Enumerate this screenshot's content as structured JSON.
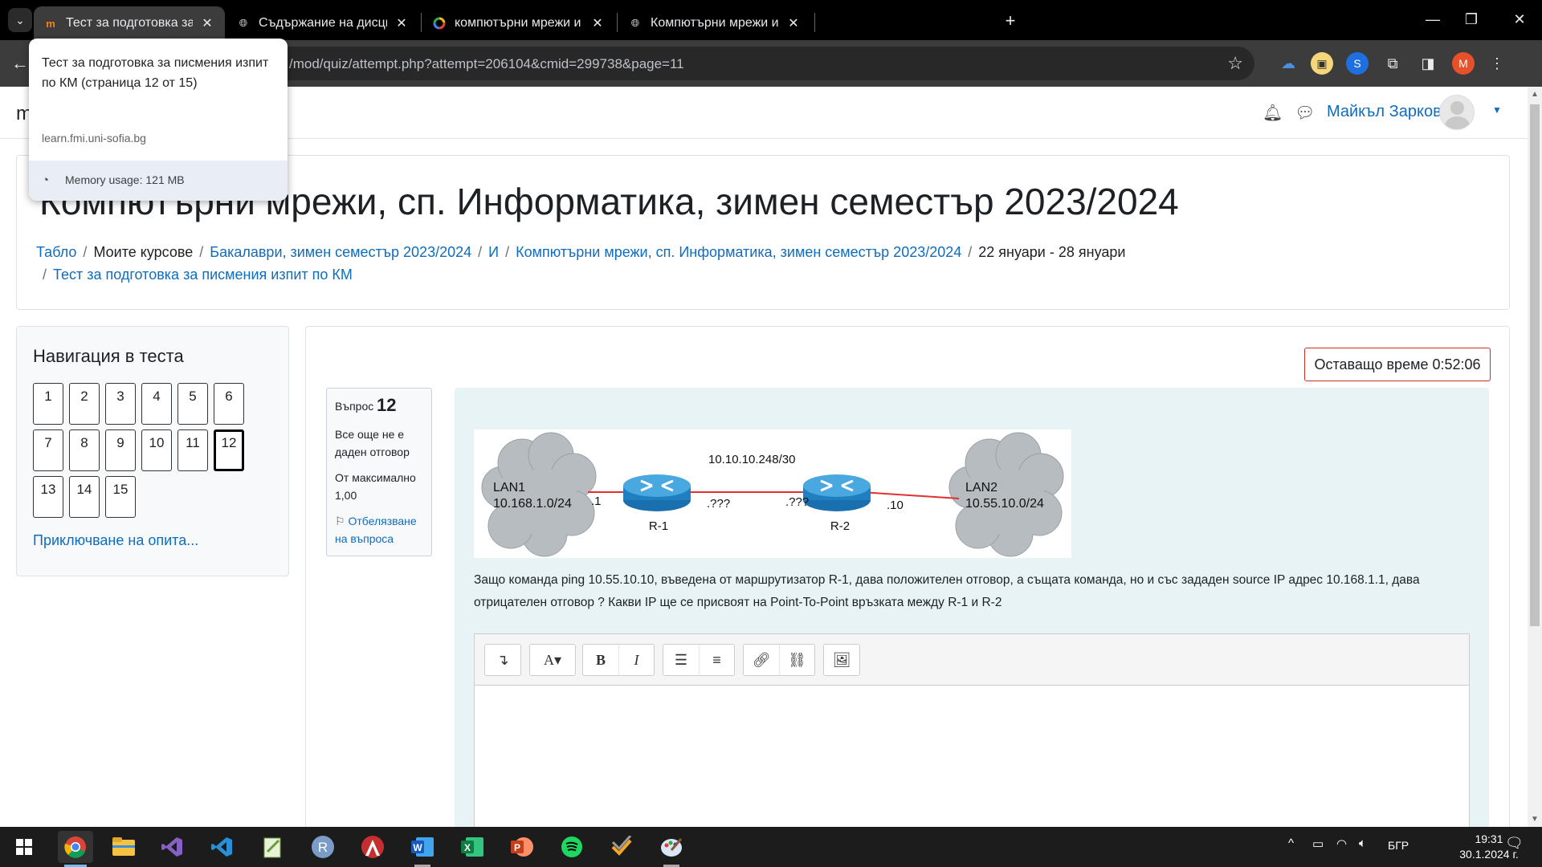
{
  "browser": {
    "tabs": [
      {
        "title": "Тест за подготовка за писмени",
        "active": true
      },
      {
        "title": "Съдържание на дисциплината",
        "active": false
      },
      {
        "title": "компютърни мрежи и телеком",
        "active": false
      },
      {
        "title": "Компютърни мрежи и телеком",
        "active": false
      }
    ],
    "url": "/mod/quiz/attempt.php?attempt=206104&cmid=299738&page=11",
    "hovercard": {
      "title": "Тест за подготовка за писмения изпит по КМ (страница 12 от 15)",
      "domain": "learn.fmi.uni-sofia.bg",
      "memory": "Memory usage: 121 MB"
    },
    "profile_initial": "M"
  },
  "header": {
    "brand_fragment": "m",
    "user_name": "Майкъл Зарков"
  },
  "course": {
    "title": "Компютърни мрежи, сп. Информатика, зимен семестър 2023/2024",
    "breadcrumb": {
      "b1": "Табло",
      "b2": "Моите курсове",
      "b3": "Бакалаври, зимен семестър 2023/2024",
      "b4": "И",
      "b5": "Компютърни мрежи, сп. Информатика, зимен семестър 2023/2024",
      "b6": "22 януари - 28 януари",
      "b7": "Тест за подготовка за писмения изпит по КМ",
      "sep": "/"
    }
  },
  "quiznav": {
    "title": "Навигация в теста",
    "buttons": [
      "1",
      "2",
      "3",
      "4",
      "5",
      "6",
      "7",
      "8",
      "9",
      "10",
      "11",
      "12",
      "13",
      "14",
      "15"
    ],
    "current": "12",
    "finish_label": "Приключване на опита..."
  },
  "timer": {
    "label": "Оставащо време 0:52:06"
  },
  "question": {
    "label": "Въпрос",
    "number": "12",
    "state": "Все още не е даден отговор",
    "mark": "От максимално 1,00",
    "flag_label": "Отбелязване на въпроса",
    "text": "Защо команда ping 10.55.10.10, въведена от маршрутизатор R-1, дава положителен отговор, а същата команда, но и със зададен source IP адрес 10.168.1.1, дава отрицателен отговор ? Какви IP ще се присвоят на Point-To-Point връзката между R-1 и R-2",
    "diagram": {
      "lan1_name": "LAN1",
      "lan1_net": "10.168.1.0/24",
      "lan1_if": ".1",
      "r1": "R-1",
      "r1_if": ".???",
      "link_net": "10.10.10.248/30",
      "r2_if": ".???",
      "r2": "R-2",
      "lan2_if": ".10",
      "lan2_name": "LAN2",
      "lan2_net": "10.55.10.0/24"
    }
  },
  "editor_toolbar": [
    "collapse-icon",
    "font-style-icon",
    "bold-icon",
    "italic-icon",
    "unordered-list-icon",
    "ordered-list-icon",
    "link-icon",
    "unlink-icon",
    "image-icon"
  ],
  "taskbar": {
    "language": "БГР",
    "time": "19:31",
    "date": "30.1.2024 г."
  },
  "colors": {
    "link": "#0f6cbf",
    "timer_border": "#ca3120",
    "question_bg": "#e7f3f5",
    "router": "#1f7fbf",
    "link_line": "#e03030"
  }
}
